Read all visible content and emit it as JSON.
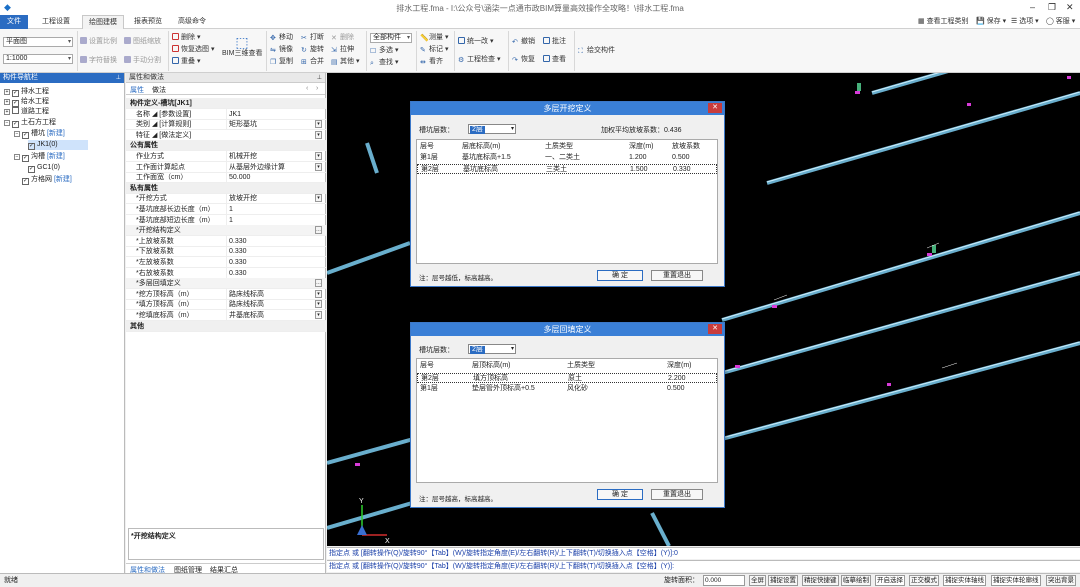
{
  "window": {
    "title": "排水工程.fma - I:\\公众号\\涵柒一点通市政BIM算量高效操作全攻略！\\排水工程.fma",
    "minimize": "–",
    "restore": "❐",
    "close": "✕"
  },
  "menu": {
    "file": "文件",
    "tabs": [
      "工程设置",
      "绘图建模",
      "报表预览",
      "高级命令"
    ],
    "right": [
      "查看工程类别",
      "保存 ▾",
      "选项 ▾",
      "客服 ▾"
    ]
  },
  "ribbon": {
    "view_combo": "平面图",
    "scale_combo": "1:1000",
    "g1": [
      "设置比例",
      "图纸缩放",
      "字符替换",
      "手动分割"
    ],
    "g2": [
      "删除 ▾",
      "恢复选图 ▾",
      "重叠 ▾"
    ],
    "bim": "BIM三维查看",
    "g3": [
      "移动",
      "打断",
      "删除",
      "镜像",
      "旋转",
      "拉伸",
      "复制",
      "合并",
      "其他 ▾"
    ],
    "g4": [
      "全部构件",
      "多选 ▾",
      "查找 ▾"
    ],
    "g5": [
      "测量 ▾",
      "标记 ▾",
      "看齐"
    ],
    "g6": [
      "统一改 ▾",
      "工程检查 ▾"
    ],
    "g7": [
      "撤销",
      "恢复",
      "批注",
      "查看"
    ],
    "g8": "绘交构件"
  },
  "nav": {
    "title": "构件导航栏",
    "pin": "📌",
    "items": [
      {
        "label": "排水工程",
        "new": ""
      },
      {
        "label": "给水工程",
        "new": ""
      },
      {
        "label": "道路工程",
        "new": ""
      },
      {
        "label": "土石方工程",
        "new": ""
      },
      {
        "label": "槽坑",
        "new": "[新建]"
      },
      {
        "label": "JK1(0)",
        "new": ""
      },
      {
        "label": "沟槽",
        "new": "[新建]"
      },
      {
        "label": "GC1(0)",
        "new": ""
      },
      {
        "label": "方格网",
        "new": "[新建]"
      }
    ]
  },
  "props": {
    "title": "属性和做法",
    "tab1": "属性",
    "tab2": "做法",
    "rows": [
      {
        "k": "构件定义-槽坑[JK1]",
        "v": "",
        "sec": true
      },
      {
        "k": "名称 ◢ [参数设置]",
        "v": "JK1"
      },
      {
        "k": "类别 ◢ [计算规则]",
        "v": "矩形基坑"
      },
      {
        "k": "特征 ◢ [做法定义]",
        "v": ""
      },
      {
        "k": "公有属性",
        "v": "",
        "sec": true
      },
      {
        "k": "作业方式",
        "v": "机械开挖"
      },
      {
        "k": "工作面计算起点",
        "v": "从基层外边缘计算"
      },
      {
        "k": "工作面宽（cm）",
        "v": "50.000"
      },
      {
        "k": "私有属性",
        "v": "",
        "sec": true
      },
      {
        "k": "*开挖方式",
        "v": "放坡开挖"
      },
      {
        "k": "*基坑底部长边长度（m）",
        "v": "1"
      },
      {
        "k": "*基坑底部短边长度（m）",
        "v": "1"
      },
      {
        "k": "*开挖结构定义",
        "v": ""
      },
      {
        "k": "*上放坡系数",
        "v": "0.330"
      },
      {
        "k": "*下放坡系数",
        "v": "0.330"
      },
      {
        "k": "*左放坡系数",
        "v": "0.330"
      },
      {
        "k": "*右放坡系数",
        "v": "0.330"
      },
      {
        "k": "*多层回填定义",
        "v": ""
      },
      {
        "k": "*挖方顶标高（m）",
        "v": "路床线标高"
      },
      {
        "k": "*填方顶标高（m）",
        "v": "路床线标高"
      },
      {
        "k": "*挖填底标高（m）",
        "v": "井基底标高"
      },
      {
        "k": "其他",
        "v": "",
        "sec": true
      }
    ],
    "desc": "*开挖结构定义",
    "bottom_tabs": [
      "属性和做法",
      "图纸管理",
      "结果汇总"
    ]
  },
  "dialog1": {
    "title": "多层开挖定义",
    "layers_label": "槽坑层数：",
    "layers_value": "2层",
    "avg_label": "加权平均放坡系数：0.436",
    "headers": [
      "层号",
      "层底标高(m)",
      "土质类型",
      "深度(m)",
      "放坡系数"
    ],
    "rows": [
      [
        "第1层",
        "基坑底标高+1.5",
        "一、二类土",
        "1.200",
        "0.500"
      ],
      [
        "第2层",
        "基坑底标高",
        "三类土",
        "1.500",
        "0.330"
      ]
    ],
    "note": "注：层号越低，标高越高。",
    "ok": "确  定",
    "cancel": "重置退出"
  },
  "dialog2": {
    "title": "多层回填定义",
    "layers_label": "槽坑层数：",
    "layers_value": "2层",
    "headers": [
      "层号",
      "层顶标高(m)",
      "土质类型",
      "深度(m)"
    ],
    "rows": [
      [
        "第2层",
        "填方顶标高",
        "原土",
        "2.200"
      ],
      [
        "第1层",
        "垫层管外顶标高+0.5",
        "风化砂",
        "0.500"
      ]
    ],
    "note": "注：层号越高，标高越高。",
    "ok": "确  定",
    "cancel": "重置退出"
  },
  "cmd": {
    "line1": "指定点 或 [翻转操作(Q)/旋转90°【Tab】(W)/旋转指定角度(E)/左右翻转(R)/上下翻转(T)/切换插入点【空格】(Y)]:0",
    "line2": "指定点 或 [翻转操作(Q)/旋转90°【Tab】(W)/旋转指定角度(E)/左右翻转(R)/上下翻转(T)/切换插入点【空格】(Y)]:"
  },
  "status": {
    "ready": "就绪",
    "rotate_label": "旋转面积：",
    "rotate_value": "0.000",
    "buttons": [
      "全屏",
      "捕捉设置",
      "精捉快捷键",
      "临摹绘制",
      "开启选择",
      "正交模式",
      "捕捉实体轴线",
      "捕捉实体轮廓线",
      "突出背景"
    ]
  },
  "colors": {
    "accent": "#2b6cc2",
    "canvas": "#000000",
    "pipe": "#9bd7f0"
  }
}
